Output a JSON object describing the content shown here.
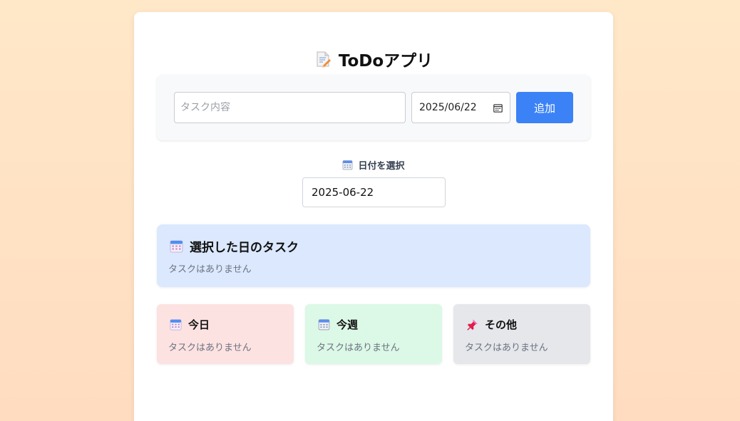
{
  "app": {
    "title": "ToDoアプリ",
    "title_icon": "memo-icon"
  },
  "form": {
    "task_placeholder": "タスク内容",
    "task_value": "",
    "date_value": "2025/06/22",
    "add_label": "追加",
    "accent": "#3b82f6"
  },
  "picker": {
    "label": "日付を選択",
    "value": "2025-06-22",
    "icon": "calendar-icon"
  },
  "selected": {
    "title": "選択した日のタスク",
    "empty": "タスクはありません",
    "icon": "calendar-icon",
    "color": "#dbe8fe"
  },
  "groups": [
    {
      "title": "今日",
      "empty": "タスクはありません",
      "icon": "calendar-icon",
      "color": "#fde2e2"
    },
    {
      "title": "今週",
      "empty": "タスクはありません",
      "icon": "calendar-icon",
      "color": "#dcf8e6"
    },
    {
      "title": "その他",
      "empty": "タスクはありません",
      "icon": "pushpin-icon",
      "color": "#e5e7eb"
    }
  ]
}
